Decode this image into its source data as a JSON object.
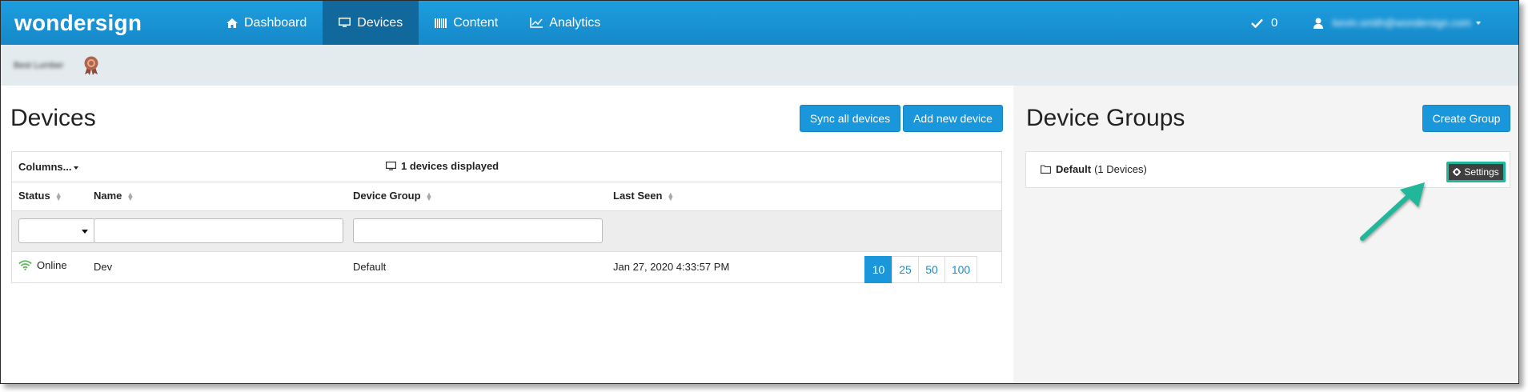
{
  "app": {
    "brand": "wondersign",
    "nav": [
      {
        "label": "Dashboard",
        "icon": "home-icon",
        "active": false
      },
      {
        "label": "Devices",
        "icon": "monitor-icon",
        "active": true
      },
      {
        "label": "Content",
        "icon": "barcode-icon",
        "active": false
      },
      {
        "label": "Analytics",
        "icon": "line-chart-icon",
        "active": false
      }
    ],
    "tasks_count": "0",
    "user_email": "kevin.smith@wondersign.com",
    "account_name": "Best Lumber"
  },
  "devices": {
    "title": "Devices",
    "sync_label": "Sync all devices",
    "add_label": "Add new device",
    "columns_label": "Columns...",
    "displayed_label": "1 devices displayed",
    "headers": [
      "Status",
      "Name",
      "Device Group",
      "Last Seen"
    ],
    "rows": [
      {
        "status": "Online",
        "name": "Dev",
        "group": "Default",
        "last_seen": "Jan 27, 2020 4:33:57 PM"
      }
    ],
    "page_sizes": [
      "10",
      "25",
      "50",
      "100"
    ],
    "active_page_size": "10"
  },
  "groups": {
    "title": "Device Groups",
    "create_label": "Create Group",
    "items": [
      {
        "name": "Default",
        "count": "(1 Devices)"
      }
    ],
    "settings_label": "Settings"
  },
  "colors": {
    "accent": "#1a96db",
    "nav_active": "#11689c",
    "online_green": "#5cb85c",
    "annotation": "#21b79a"
  }
}
